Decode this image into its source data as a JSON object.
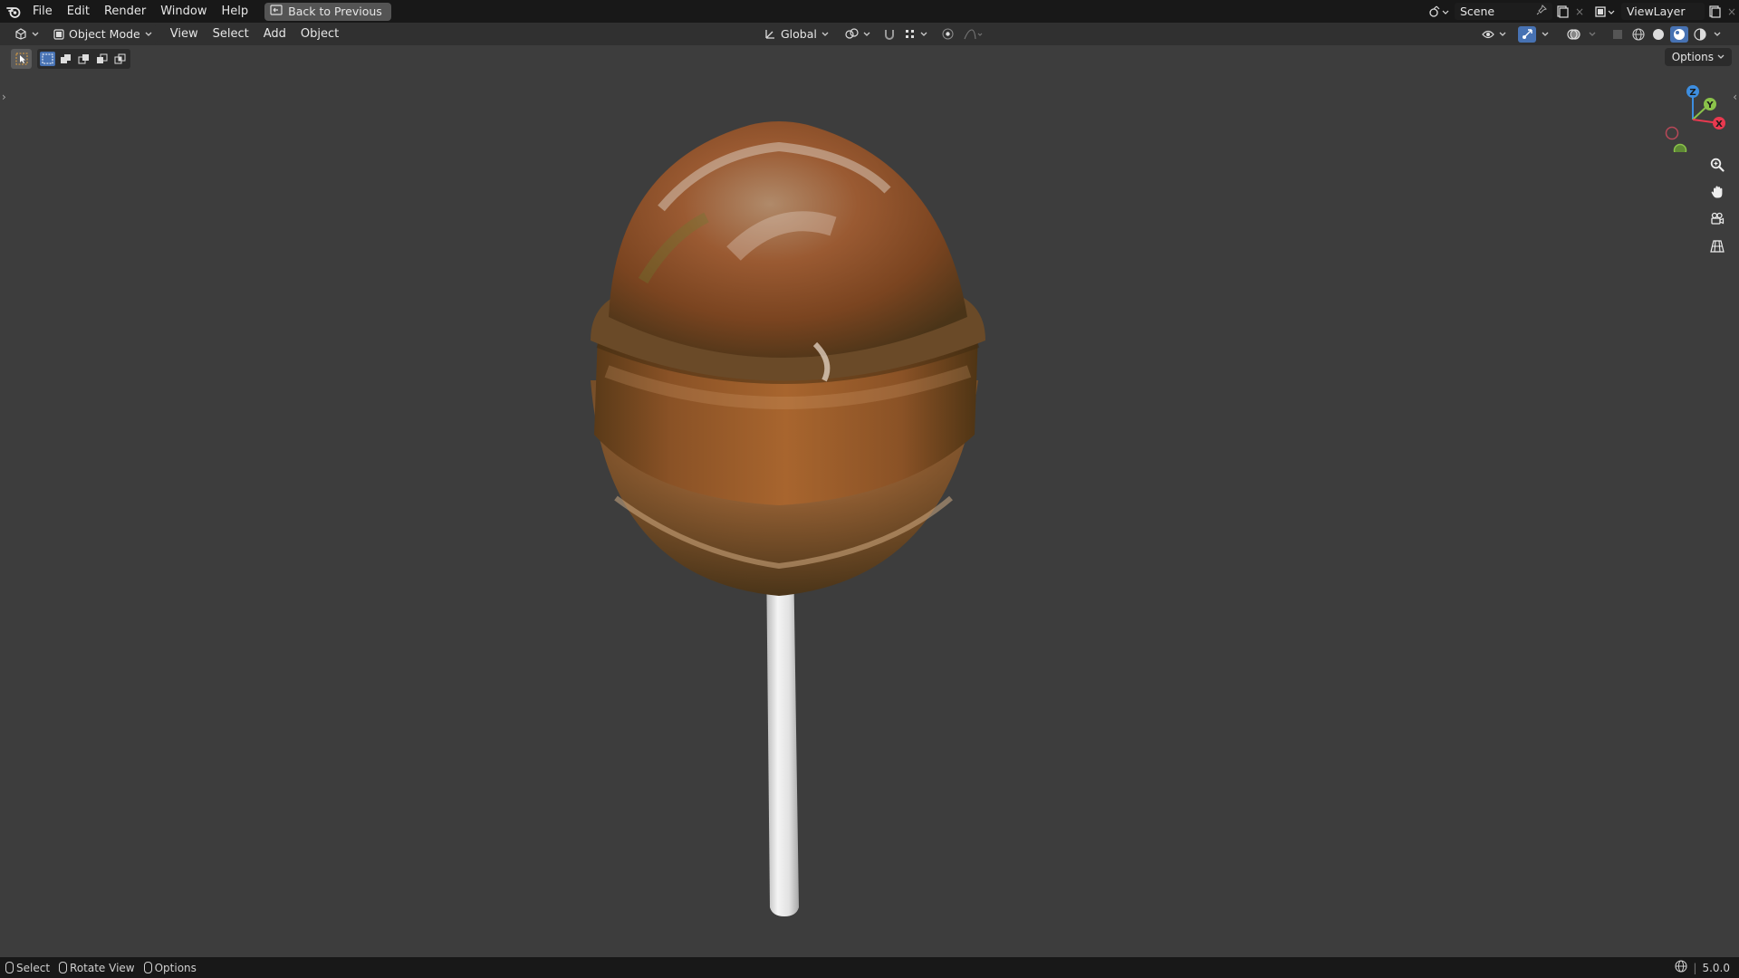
{
  "topbar": {
    "logo_icon": "blender-logo-icon",
    "menus": [
      "File",
      "Edit",
      "Render",
      "Window",
      "Help"
    ],
    "back_button": "Back to Previous",
    "scene_name": "Scene",
    "view_layer_name": "ViewLayer"
  },
  "header": {
    "mode": "Object Mode",
    "menus": [
      "View",
      "Select",
      "Add",
      "Object"
    ],
    "transform_orientation": "Global"
  },
  "viewport": {
    "options_label": "Options",
    "gizmo_axes": [
      "Z",
      "Y",
      "X"
    ],
    "object": "lollipop"
  },
  "statusbar": {
    "items": [
      "Select",
      "Rotate View",
      "Options"
    ],
    "version": "5.0.0"
  },
  "colors": {
    "axis_x": "#e8394f",
    "axis_y": "#8bc34a",
    "axis_z": "#3d8ee0",
    "accent_blue": "#4772b3"
  }
}
